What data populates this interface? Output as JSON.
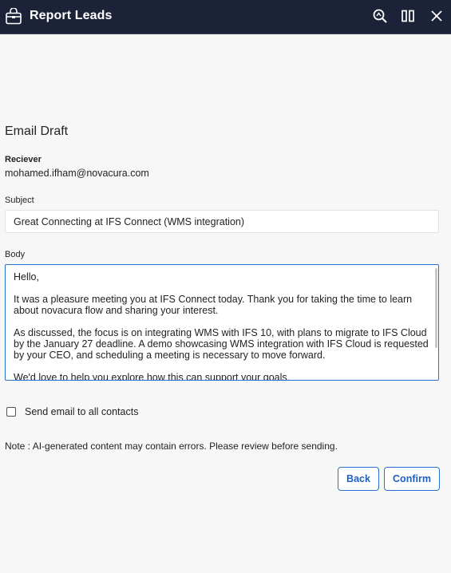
{
  "window": {
    "title": "Report Leads",
    "icons": {
      "app": "briefcase-lock-icon",
      "zoom": "zoom-icon",
      "split": "split-view-icon",
      "close": "close-icon"
    }
  },
  "form": {
    "title": "Email Draft",
    "receiver": {
      "label": "Reciever",
      "value": "mohamed.ifham@novacura.com"
    },
    "subject": {
      "label": "Subject",
      "value": "Great Connecting at IFS Connect (WMS integration)"
    },
    "body": {
      "label": "Body",
      "value": "Hello,\n\nIt was a pleasure meeting you at IFS Connect today. Thank you for taking the time to learn about novacura flow and sharing your interest.\n\nAs discussed, the focus is on integrating WMS with IFS 10, with plans to migrate to IFS Cloud by the January 27 deadline. A demo showcasing WMS integration with IFS Cloud is requested by your CEO, and scheduling a meeting is necessary to move forward.\n\nWe'd love to help you explore how this can support your goals."
    },
    "send_all": {
      "label": "Send email to all contacts",
      "checked": false
    },
    "note": "Note : AI-generated content may contain errors. Please review before sending.",
    "buttons": {
      "back": "Back",
      "confirm": "Confirm"
    }
  },
  "colors": {
    "titlebar": "#1c2237",
    "accent": "#2a6fd6"
  }
}
